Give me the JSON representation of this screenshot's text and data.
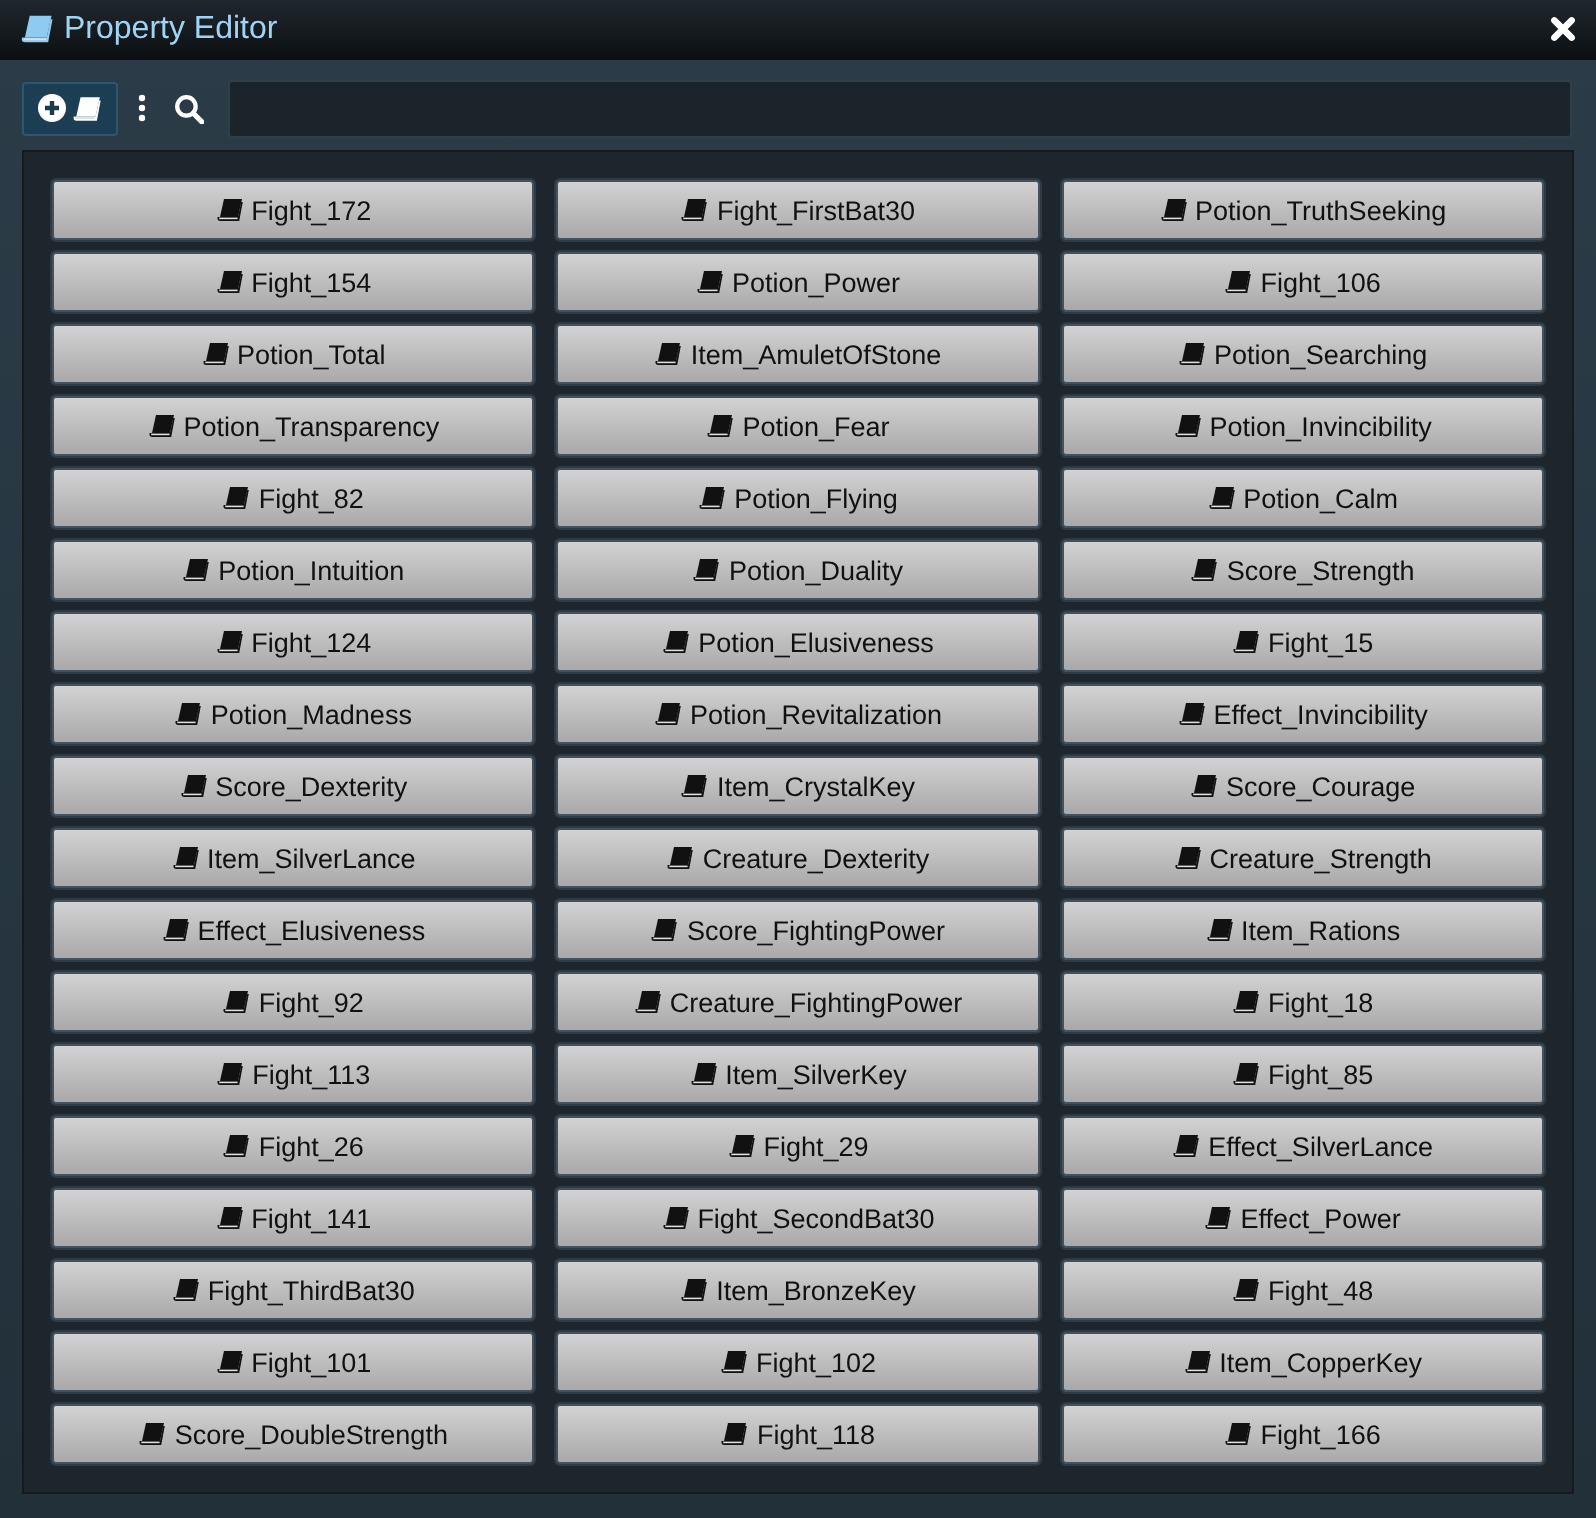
{
  "window": {
    "title": "Property Editor"
  },
  "properties": [
    "Fight_172",
    "Fight_FirstBat30",
    "Potion_TruthSeeking",
    "Fight_154",
    "Potion_Power",
    "Fight_106",
    "Potion_Total",
    "Item_AmuletOfStone",
    "Potion_Searching",
    "Potion_Transparency",
    "Potion_Fear",
    "Potion_Invincibility",
    "Fight_82",
    "Potion_Flying",
    "Potion_Calm",
    "Potion_Intuition",
    "Potion_Duality",
    "Score_Strength",
    "Fight_124",
    "Potion_Elusiveness",
    "Fight_15",
    "Potion_Madness",
    "Potion_Revitalization",
    "Effect_Invincibility",
    "Score_Dexterity",
    "Item_CrystalKey",
    "Score_Courage",
    "Item_SilverLance",
    "Creature_Dexterity",
    "Creature_Strength",
    "Effect_Elusiveness",
    "Score_FightingPower",
    "Item_Rations",
    "Fight_92",
    "Creature_FightingPower",
    "Fight_18",
    "Fight_113",
    "Item_SilverKey",
    "Fight_85",
    "Fight_26",
    "Fight_29",
    "Effect_SilverLance",
    "Fight_141",
    "Fight_SecondBat30",
    "Effect_Power",
    "Fight_ThirdBat30",
    "Item_BronzeKey",
    "Fight_48",
    "Fight_101",
    "Fight_102",
    "Item_CopperKey",
    "Score_DoubleStrength",
    "Fight_118",
    "Fight_166"
  ]
}
